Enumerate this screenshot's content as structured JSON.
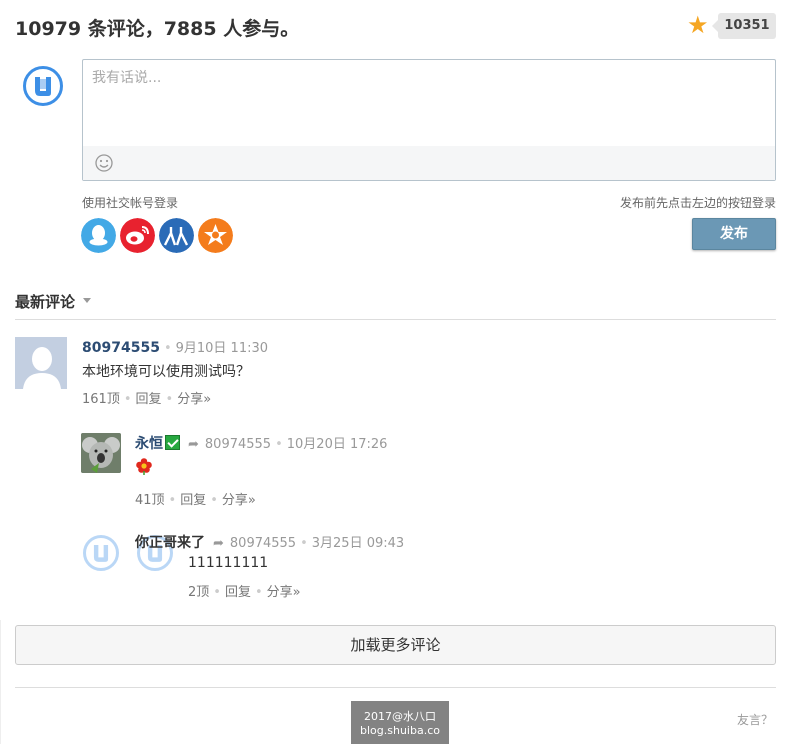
{
  "header": {
    "title": "10979 条评论，7885 人参与。",
    "fav_count": "10351"
  },
  "editor": {
    "placeholder": "我有话说..."
  },
  "social": {
    "label": "使用社交帐号登录",
    "login_tip": "发布前先点击左边的按钮登录",
    "publish": "发布",
    "providers": [
      "qq-icon",
      "weibo-icon",
      "renren-icon",
      "kaixin-icon"
    ]
  },
  "sort": {
    "label": "最新评论"
  },
  "comments": [
    {
      "user": "80974555",
      "date": "9月10日 11:30",
      "text": "本地环境可以使用测试吗？",
      "likes": "161顶",
      "reply": "回复",
      "share": "分享»"
    },
    {
      "user": "永恒",
      "reply_to": "80974555",
      "date": "10月20日 17:26",
      "likes": "41顶",
      "reply": "回复",
      "share": "分享»"
    },
    {
      "user": "你正哥来了",
      "reply_to": "80974555",
      "date": "3月25日 09:43",
      "text": "111111111",
      "likes": "2顶",
      "reply": "回复",
      "share": "分享»"
    }
  ],
  "load_more": "加载更多评论",
  "watermark": {
    "line1": "2017@水八口",
    "line2": "blog.shuiba.co"
  },
  "footer_link": "友言？",
  "colors": {
    "accent": "#6b98b5",
    "username": "#2c4c73",
    "star": "#f5a623"
  }
}
